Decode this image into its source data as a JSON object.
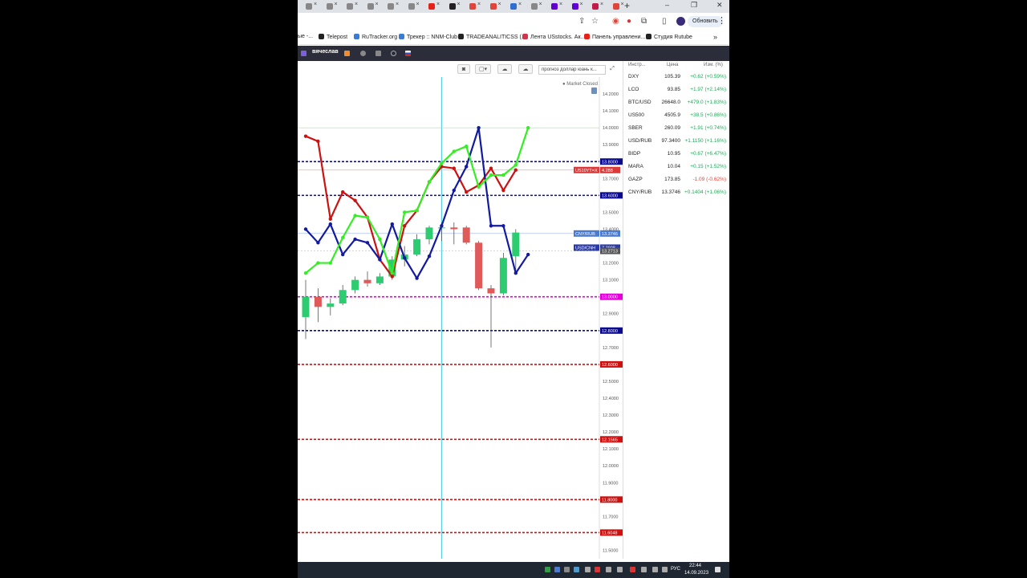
{
  "browser": {
    "tabs": [
      {
        "icon": "page-icon",
        "color": "#888888"
      },
      {
        "icon": "page-icon",
        "color": "#888888"
      },
      {
        "icon": "page-icon",
        "color": "#888888"
      },
      {
        "icon": "page-icon",
        "color": "#888888"
      },
      {
        "icon": "page-icon",
        "color": "#888888"
      },
      {
        "icon": "page-icon",
        "color": "#888888"
      },
      {
        "icon": "youtube-icon",
        "color": "#e62117"
      },
      {
        "icon": "github-icon",
        "color": "#222222"
      },
      {
        "icon": "opera-icon",
        "color": "#e0453a"
      },
      {
        "icon": "opera-icon",
        "color": "#e0453a"
      },
      {
        "icon": "globe-icon",
        "color": "#2f6fd1"
      },
      {
        "icon": "page-icon",
        "color": "#888888"
      },
      {
        "icon": "yahoo-icon",
        "color": "#6001d2"
      },
      {
        "icon": "yahoo-icon",
        "color": "#6001d2"
      },
      {
        "icon": "heart-icon",
        "color": "#c41a4b"
      },
      {
        "icon": "opera-icon",
        "color": "#e0453a"
      }
    ],
    "update_label": "Обновить",
    "bookmarks": [
      {
        "label": "ые -...",
        "color": "#999999"
      },
      {
        "label": "Telepost",
        "color": "#222222"
      },
      {
        "label": "RuTracker.org",
        "color": "#3b7bd4"
      },
      {
        "label": "Трекер :: NNM-Club",
        "color": "#3b7bd4"
      },
      {
        "label": "TRADEANALITICSS (...",
        "color": "#222222"
      },
      {
        "label": "Лента USstocks. Ак...",
        "color": "#d1344b"
      },
      {
        "label": "Панель управлени...",
        "color": "#e62117"
      },
      {
        "label": "Студия Rutube",
        "color": "#222222"
      }
    ]
  },
  "app": {
    "user_name": "вячеслав"
  },
  "toolbar": {
    "forecast_label": "прогноз доллар юань к..."
  },
  "market_status": "● Market Closed",
  "chart_data": {
    "type": "line",
    "y_ticks": [
      14.2,
      14.1,
      14.0,
      13.9,
      13.7,
      13.6,
      13.5,
      13.4,
      13.2,
      13.1,
      12.9,
      12.7,
      12.5,
      12.4,
      12.3,
      12.2,
      12.1,
      12.0,
      11.9,
      11.7,
      11.5
    ],
    "y_tick_labels": [
      "14.2000",
      "14.1000",
      "14.0000",
      "13.9000",
      "13.7000",
      "13.6000",
      "13.5000",
      "13.4000",
      "13.2000",
      "13.1000",
      "12.9000",
      "12.7000",
      "12.5000",
      "12.4000",
      "12.3000",
      "12.2000",
      "12.1000",
      "12.0000",
      "11.9000",
      "11.7000",
      "11.5000"
    ],
    "ylim": [
      11.45,
      14.3
    ],
    "n_bars": 19,
    "candles": [
      {
        "o": 12.88,
        "h": 13.1,
        "l": 12.75,
        "c": 13.0
      },
      {
        "o": 13.0,
        "h": 13.05,
        "l": 12.85,
        "c": 12.94
      },
      {
        "o": 12.94,
        "h": 12.99,
        "l": 12.89,
        "c": 12.96
      },
      {
        "o": 12.96,
        "h": 13.07,
        "l": 12.95,
        "c": 13.04
      },
      {
        "o": 13.04,
        "h": 13.12,
        "l": 13.02,
        "c": 13.1
      },
      {
        "o": 13.1,
        "h": 13.15,
        "l": 13.06,
        "c": 13.08
      },
      {
        "o": 13.08,
        "h": 13.14,
        "l": 13.07,
        "c": 13.12
      },
      {
        "o": 13.12,
        "h": 13.24,
        "l": 13.1,
        "c": 13.22
      },
      {
        "o": 13.22,
        "h": 13.3,
        "l": 13.18,
        "c": 13.25
      },
      {
        "o": 13.25,
        "h": 13.37,
        "l": 13.24,
        "c": 13.34
      },
      {
        "o": 13.34,
        "h": 13.42,
        "l": 13.31,
        "c": 13.41
      },
      {
        "o": 13.41,
        "h": 13.44,
        "l": 13.33,
        "c": 13.41
      },
      {
        "o": 13.41,
        "h": 13.44,
        "l": 13.31,
        "c": 13.4
      },
      {
        "o": 13.41,
        "h": 13.42,
        "l": 13.31,
        "c": 13.32
      },
      {
        "o": 13.32,
        "h": 13.33,
        "l": 13.04,
        "c": 13.05
      },
      {
        "o": 13.05,
        "h": 13.07,
        "l": 12.7,
        "c": 13.02
      },
      {
        "o": 13.02,
        "h": 13.26,
        "l": 13.01,
        "c": 13.23
      },
      {
        "o": 13.24,
        "h": 13.4,
        "l": 13.15,
        "c": 13.38
      }
    ],
    "series": [
      {
        "color": "#cc1111",
        "values": [
          13.95,
          13.92,
          13.46,
          13.62,
          13.57,
          13.47,
          13.22,
          13.12,
          13.42,
          13.51,
          13.68,
          13.77,
          13.76,
          13.62,
          13.66,
          13.76,
          13.63,
          13.75
        ]
      },
      {
        "color": "#111aa0",
        "values": [
          13.4,
          13.32,
          13.43,
          13.25,
          13.34,
          13.32,
          13.22,
          13.43,
          13.23,
          13.11,
          13.24,
          13.42,
          13.63,
          13.77,
          14.0,
          13.42,
          13.42,
          13.14,
          13.25
        ]
      },
      {
        "color": "#33ee22",
        "values": [
          13.14,
          13.2,
          13.2,
          13.35,
          13.48,
          13.47,
          13.34,
          13.14,
          13.5,
          13.51,
          13.68,
          13.79,
          13.86,
          13.89,
          13.65,
          13.72,
          13.72,
          13.78,
          14.0
        ]
      }
    ],
    "h_levels": [
      {
        "value": 13.8,
        "color": "#0a0a8a",
        "label": "13.8000"
      },
      {
        "value": 13.6,
        "color": "#0a0a8a",
        "label": "13.6000"
      },
      {
        "value": 13.0,
        "color": "#e100d8",
        "label": "13.0000"
      },
      {
        "value": 12.8,
        "color": "#0a0a8a",
        "label": "12.8000"
      },
      {
        "value": 12.6,
        "color": "#cc1111",
        "label": "12.6000"
      },
      {
        "value": 12.1565,
        "color": "#cc1111",
        "label": "12.1565"
      },
      {
        "value": 11.8,
        "color": "#cc1111",
        "label": "11.8000"
      },
      {
        "value": 11.6048,
        "color": "#cc1111",
        "label": "11.6048"
      }
    ],
    "tags": [
      {
        "value": 13.75,
        "name": "US10YT=X",
        "price": "4.288",
        "color": "#d93a3a"
      },
      {
        "value": 13.3746,
        "name": "CNY/RUB",
        "price": "13.3746",
        "color": "#4a7bd0"
      },
      {
        "value": 13.2908,
        "name": "USD/CNH",
        "price": "7.2908",
        "color": "#2a3aa8"
      },
      {
        "value": 13.2713,
        "name": "",
        "price": "13.2713",
        "color": "#555555"
      }
    ],
    "cursor_bar": 11
  },
  "watchlist": {
    "headers": {
      "symbol": "Инстр...",
      "price": "Цена",
      "change": "Изм. (%)"
    },
    "rows": [
      {
        "symbol": "DXY",
        "price": "105.39",
        "change": "+0.62 (+0.59%)",
        "dir": "up"
      },
      {
        "symbol": "LCO",
        "price": "93.85",
        "change": "+1.97 (+2.14%)",
        "dir": "up"
      },
      {
        "symbol": "BTC/USD",
        "price": "26648.0",
        "change": "+479.0 (+1.83%)",
        "dir": "up"
      },
      {
        "symbol": "US500",
        "price": "4505.9",
        "change": "+38.5 (+0.86%)",
        "dir": "up"
      },
      {
        "symbol": "SBER",
        "price": "260.09",
        "change": "+1.91 (+0.74%)",
        "dir": "up"
      },
      {
        "symbol": "USD/RUB",
        "price": "97.3400",
        "change": "+1.1150 (+1.16%)",
        "dir": "up"
      },
      {
        "symbol": "BIDP",
        "price": "10.95",
        "change": "+0.67 (+6.47%)",
        "dir": "up"
      },
      {
        "symbol": "MARA",
        "price": "10.04",
        "change": "+0.15 (+1.52%)",
        "dir": "up"
      },
      {
        "symbol": "GAZP",
        "price": "173.85",
        "change": "-1.09 (-0.62%)",
        "dir": "down"
      },
      {
        "symbol": "CNY/RUB",
        "price": "13.3746",
        "change": "+0.1404 (+1.06%)",
        "dir": "up"
      }
    ],
    "up_color": "#26a65b",
    "down_color": "#e0453a"
  },
  "taskbar": {
    "lang": "РУС",
    "time": "22:44",
    "date": "14.09.2023"
  }
}
